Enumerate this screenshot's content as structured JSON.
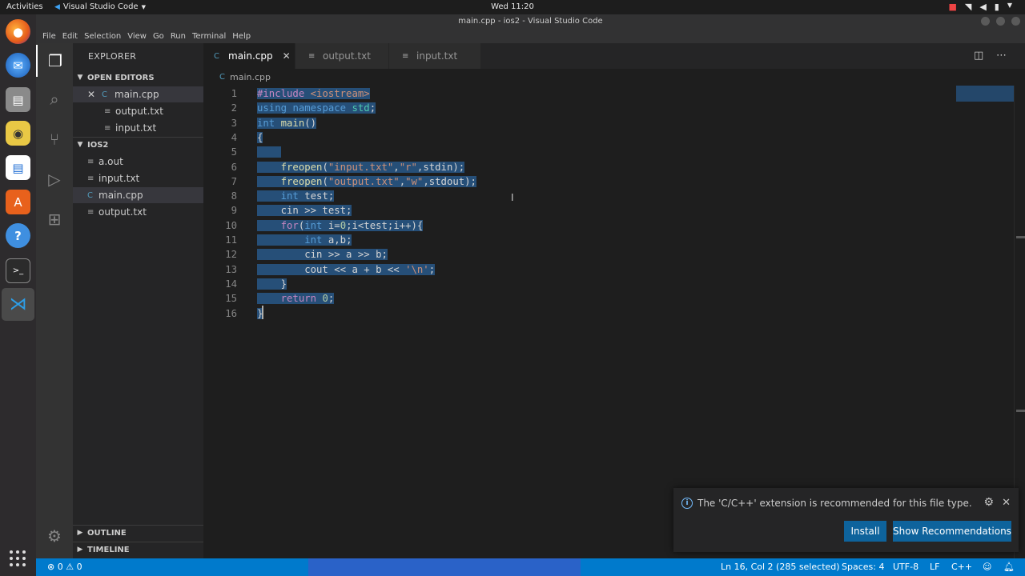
{
  "topbar": {
    "activities": "Activities",
    "app_name": "Visual Studio Code",
    "clock": "Wed 11:20"
  },
  "dock": {
    "apps": [
      "firefox-icon",
      "thunderbird-icon",
      "files-icon",
      "rhythmbox-icon",
      "writer-icon",
      "software-icon",
      "help-icon",
      "terminal-icon",
      "vscode-icon"
    ]
  },
  "window": {
    "title": "main.cpp - ios2 - Visual Studio Code"
  },
  "menubar": {
    "items": [
      "File",
      "Edit",
      "Selection",
      "View",
      "Go",
      "Run",
      "Terminal",
      "Help"
    ]
  },
  "sidebar": {
    "header": "EXPLORER",
    "open_editors_label": "OPEN EDITORS",
    "open_editors": [
      "main.cpp",
      "output.txt",
      "input.txt"
    ],
    "folder_label": "IOS2",
    "files": [
      "a.out",
      "input.txt",
      "main.cpp",
      "output.txt"
    ],
    "outline_label": "OUTLINE",
    "timeline_label": "TIMELINE"
  },
  "tabs": [
    {
      "label": "main.cpp",
      "active": true
    },
    {
      "label": "output.txt",
      "active": false
    },
    {
      "label": "input.txt",
      "active": false
    }
  ],
  "breadcrumb": "main.cpp",
  "code_lines": [
    "#include <iostream>",
    "using namespace std;",
    "int main()",
    "{",
    "    ",
    "    freopen(\"input.txt\",\"r\",stdin);",
    "    freopen(\"output.txt\",\"w\",stdout);",
    "    int test;",
    "    cin >> test;",
    "    for(int i=0;i<test;i++){",
    "        int a,b;",
    "        cin >> a >> b;",
    "        cout << a + b << '\\n';",
    "    }",
    "    return 0;",
    "}"
  ],
  "notification": {
    "message": "The 'C/C++' extension is recommended for this file type.",
    "install_label": "Install",
    "recommend_label": "Show Recommendations"
  },
  "statusbar": {
    "errors": "0",
    "warnings": "0",
    "position": "Ln 16, Col 2 (285 selected)",
    "spaces": "Spaces: 4",
    "encoding": "UTF-8",
    "eol": "LF",
    "language": "C++"
  },
  "colors": {
    "accent": "#007acc",
    "selection": "#264f78",
    "button": "#0e639c"
  }
}
